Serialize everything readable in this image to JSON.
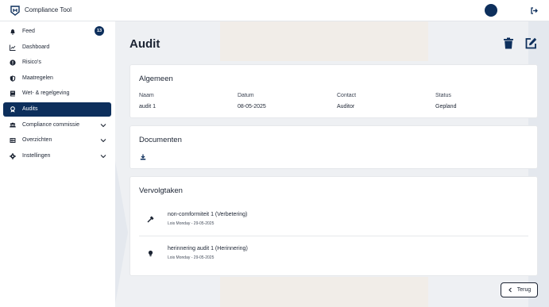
{
  "app": {
    "title": "Compliance Tool"
  },
  "sidebar": {
    "items": [
      {
        "label": "Feed",
        "icon": "bell-icon",
        "badge": "13"
      },
      {
        "label": "Dashboard",
        "icon": "chart-line-icon"
      },
      {
        "label": "Risico's",
        "icon": "alert-circle-icon"
      },
      {
        "label": "Maatregelen",
        "icon": "shield-icon"
      },
      {
        "label": "Wet- & regelgeving",
        "icon": "book-icon"
      },
      {
        "label": "Audits",
        "icon": "audit-icon",
        "active": true
      },
      {
        "label": "Compliance commissie",
        "icon": "users-icon",
        "expandable": true
      },
      {
        "label": "Overzichten",
        "icon": "table-icon",
        "expandable": true
      },
      {
        "label": "Instellingen",
        "icon": "gear-icon",
        "expandable": true
      }
    ]
  },
  "page": {
    "title": "Audit"
  },
  "general": {
    "title": "Algemeen",
    "columns": [
      "Naam",
      "Datum",
      "Contact",
      "Status"
    ],
    "values": [
      "audit 1",
      "08-05-2025",
      "Auditor",
      "Gepland"
    ]
  },
  "documents": {
    "title": "Documenten"
  },
  "followups": {
    "title": "Vervolgtaken",
    "tasks": [
      {
        "title": "non-comformiteit 1  (Verbetering)",
        "meta": "Lois Monday - 29-05-2025",
        "icon": "hammer-icon"
      },
      {
        "title": "herinnering audit 1  (Herinnering)",
        "meta": "Lois Monday - 29-05-2025",
        "icon": "lightbulb-icon"
      }
    ]
  },
  "actions": {
    "back_label": "Terug"
  },
  "colors": {
    "primary": "#0d2f5c",
    "background": "#eef0f3"
  }
}
